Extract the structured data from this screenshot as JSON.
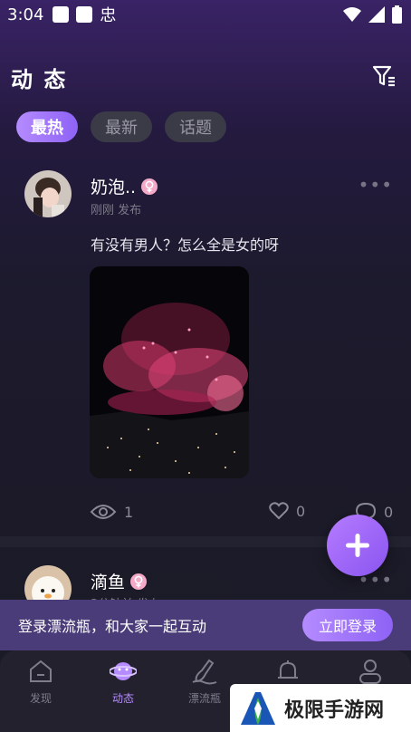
{
  "status": {
    "time": "3:04",
    "app_glyph": "忠"
  },
  "header": {
    "title": "动 态"
  },
  "tabs": [
    {
      "label": "最热",
      "active": true
    },
    {
      "label": "最新",
      "active": false
    },
    {
      "label": "话题",
      "active": false
    }
  ],
  "posts": [
    {
      "name": "奶泡..",
      "meta": "刚刚 发布",
      "text": "有没有男人？怎么全是女的呀",
      "views": "1",
      "likes": "0",
      "comments": "0"
    },
    {
      "name": "滴鱼",
      "meta": "3分钟前 发布"
    }
  ],
  "login_bar": {
    "text": "登录漂流瓶，和大家一起互动",
    "button": "立即登录"
  },
  "nav": [
    {
      "label": "发现",
      "icon": "home-icon"
    },
    {
      "label": "动态",
      "icon": "planet-icon",
      "active": true
    },
    {
      "label": "漂流瓶",
      "icon": "bottle-icon"
    },
    {
      "label": "",
      "icon": "bell-icon"
    },
    {
      "label": "",
      "icon": "profile-icon"
    }
  ],
  "watermark": {
    "text": "极限手游网"
  },
  "colors": {
    "accent": "#9b6bff",
    "gender_female": "#f3a9c7"
  }
}
